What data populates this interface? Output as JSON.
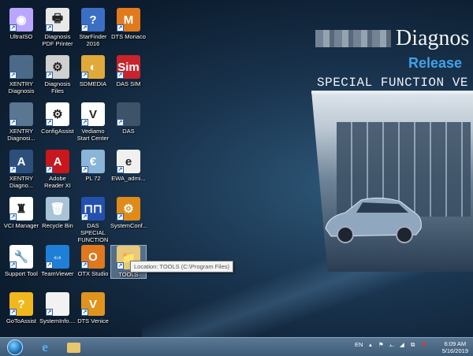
{
  "wallpaper": {
    "title": "Diagnos",
    "release": "Release",
    "subtitle": "SPECIAL FUNCTION VE"
  },
  "icons": [
    {
      "label": "UltraISO",
      "color": "#b9a7ff",
      "glyph": "◉"
    },
    {
      "label": "Diagnosis PDF Printer",
      "color": "#e8e8e8",
      "glyph": "🖶"
    },
    {
      "label": "StarFinder 2016",
      "color": "#3b6fc4",
      "glyph": "?"
    },
    {
      "label": "DTS Monaco",
      "color": "#e07a1c",
      "glyph": "M"
    },
    {
      "label": "XENTRY Diagnosis",
      "color": "#4c6a88",
      "glyph": ""
    },
    {
      "label": "Diagnosis Files",
      "color": "#d0d0d0",
      "glyph": "⚙"
    },
    {
      "label": "SDMEDIA",
      "color": "#e0a93a",
      "glyph": "◐"
    },
    {
      "label": "DAS SIM",
      "color": "#c9242b",
      "glyph": "Sim"
    },
    {
      "label": "XENTRY Diagnosi...",
      "color": "#5a7690",
      "glyph": ""
    },
    {
      "label": "ConfigAssist",
      "color": "#ffffff",
      "glyph": "⚙"
    },
    {
      "label": "Vediamo Start Center",
      "color": "#ffffff",
      "glyph": "V"
    },
    {
      "label": "DAS",
      "color": "#3e5368",
      "glyph": ""
    },
    {
      "label": "XENTRY Diagno...",
      "color": "#2d4f7c",
      "glyph": "A"
    },
    {
      "label": "Adobe Reader XI",
      "color": "#c8171d",
      "glyph": "A"
    },
    {
      "label": "PL 72",
      "color": "#8ab4d8",
      "glyph": "€"
    },
    {
      "label": "EWA_admi...",
      "color": "#f0f0f0",
      "glyph": "e"
    },
    {
      "label": "VCI Manager",
      "color": "#ffffff",
      "glyph": "♜"
    },
    {
      "label": "Recycle Bin",
      "color": "#a9c3d6",
      "glyph": "🗑"
    },
    {
      "label": "DAS SPECIAL FUNCTION",
      "color": "#2350b0",
      "glyph": "⊓⊓"
    },
    {
      "label": "SystemConf...",
      "color": "#e08a1a",
      "glyph": "⚙"
    },
    {
      "label": "Support Tool",
      "color": "#ffffff",
      "glyph": "🔧"
    },
    {
      "label": "TeamViewer",
      "color": "#1f7fd6",
      "glyph": "⇔"
    },
    {
      "label": "OTX Studio",
      "color": "#e0781e",
      "glyph": "O"
    },
    {
      "label": "TOOLS",
      "color": "#e8c87a",
      "glyph": "📁",
      "selected": true
    },
    {
      "label": "GoToAssist",
      "color": "#f0b81c",
      "glyph": "?"
    },
    {
      "label": "SystemInfo....",
      "color": "#f2f2f2",
      "glyph": ""
    },
    {
      "label": "DTS Venice",
      "color": "#e0941e",
      "glyph": "V"
    }
  ],
  "tooltip": "Location: TOOLS (C:\\Program Files)",
  "taskbar": {
    "language": "EN",
    "time": "6:09 AM",
    "date": "5/16/2019"
  }
}
